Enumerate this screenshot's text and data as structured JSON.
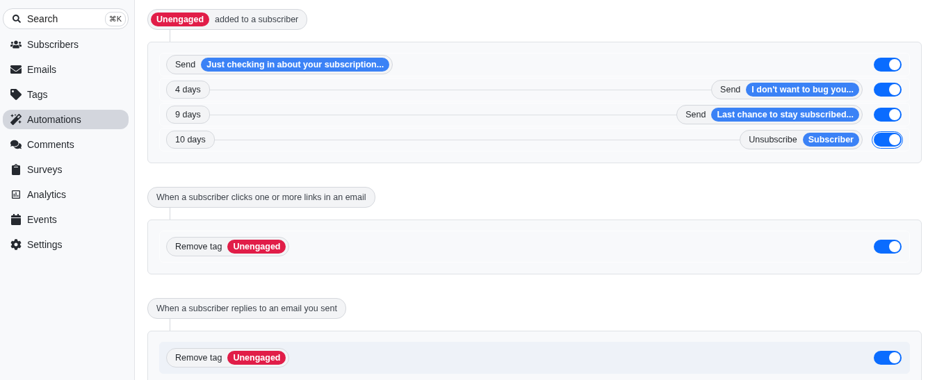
{
  "sidebar": {
    "search": {
      "placeholder": "Search",
      "shortcut": "⌘K"
    },
    "items": [
      {
        "label": "Subscribers",
        "selected": false
      },
      {
        "label": "Emails",
        "selected": false
      },
      {
        "label": "Tags",
        "selected": false
      },
      {
        "label": "Automations",
        "selected": true
      },
      {
        "label": "Comments",
        "selected": false
      },
      {
        "label": "Surveys",
        "selected": false
      },
      {
        "label": "Analytics",
        "selected": false
      },
      {
        "label": "Events",
        "selected": false
      },
      {
        "label": "Settings",
        "selected": false
      }
    ]
  },
  "automations": [
    {
      "trigger": {
        "tag": "Unengaged",
        "text": "added to a subscriber"
      },
      "steps": [
        {
          "action": "Send",
          "target": {
            "kind": "email",
            "label": "Just checking in about your subscription..."
          },
          "on": true,
          "focused": false,
          "hovered": false
        },
        {
          "delay": "4 days",
          "action": "Send",
          "target": {
            "kind": "email",
            "label": "I don't want to bug you..."
          },
          "on": true,
          "focused": false,
          "hovered": false
        },
        {
          "delay": "9 days",
          "action": "Send",
          "target": {
            "kind": "email",
            "label": "Last chance to stay subscribed..."
          },
          "on": true,
          "focused": false,
          "hovered": false
        },
        {
          "delay": "10 days",
          "action": "Unsubscribe",
          "target": {
            "kind": "subscriber",
            "label": "Subscriber"
          },
          "on": true,
          "focused": true,
          "hovered": false
        }
      ]
    },
    {
      "trigger": {
        "text": "When a subscriber clicks one or more links in an email"
      },
      "steps": [
        {
          "action": "Remove tag",
          "target": {
            "kind": "tag",
            "label": "Unengaged"
          },
          "on": true,
          "focused": false,
          "hovered": false
        }
      ]
    },
    {
      "trigger": {
        "text": "When a subscriber replies to an email you sent"
      },
      "steps": [
        {
          "action": "Remove tag",
          "target": {
            "kind": "tag",
            "label": "Unengaged"
          },
          "on": true,
          "focused": false,
          "hovered": true
        }
      ]
    }
  ]
}
